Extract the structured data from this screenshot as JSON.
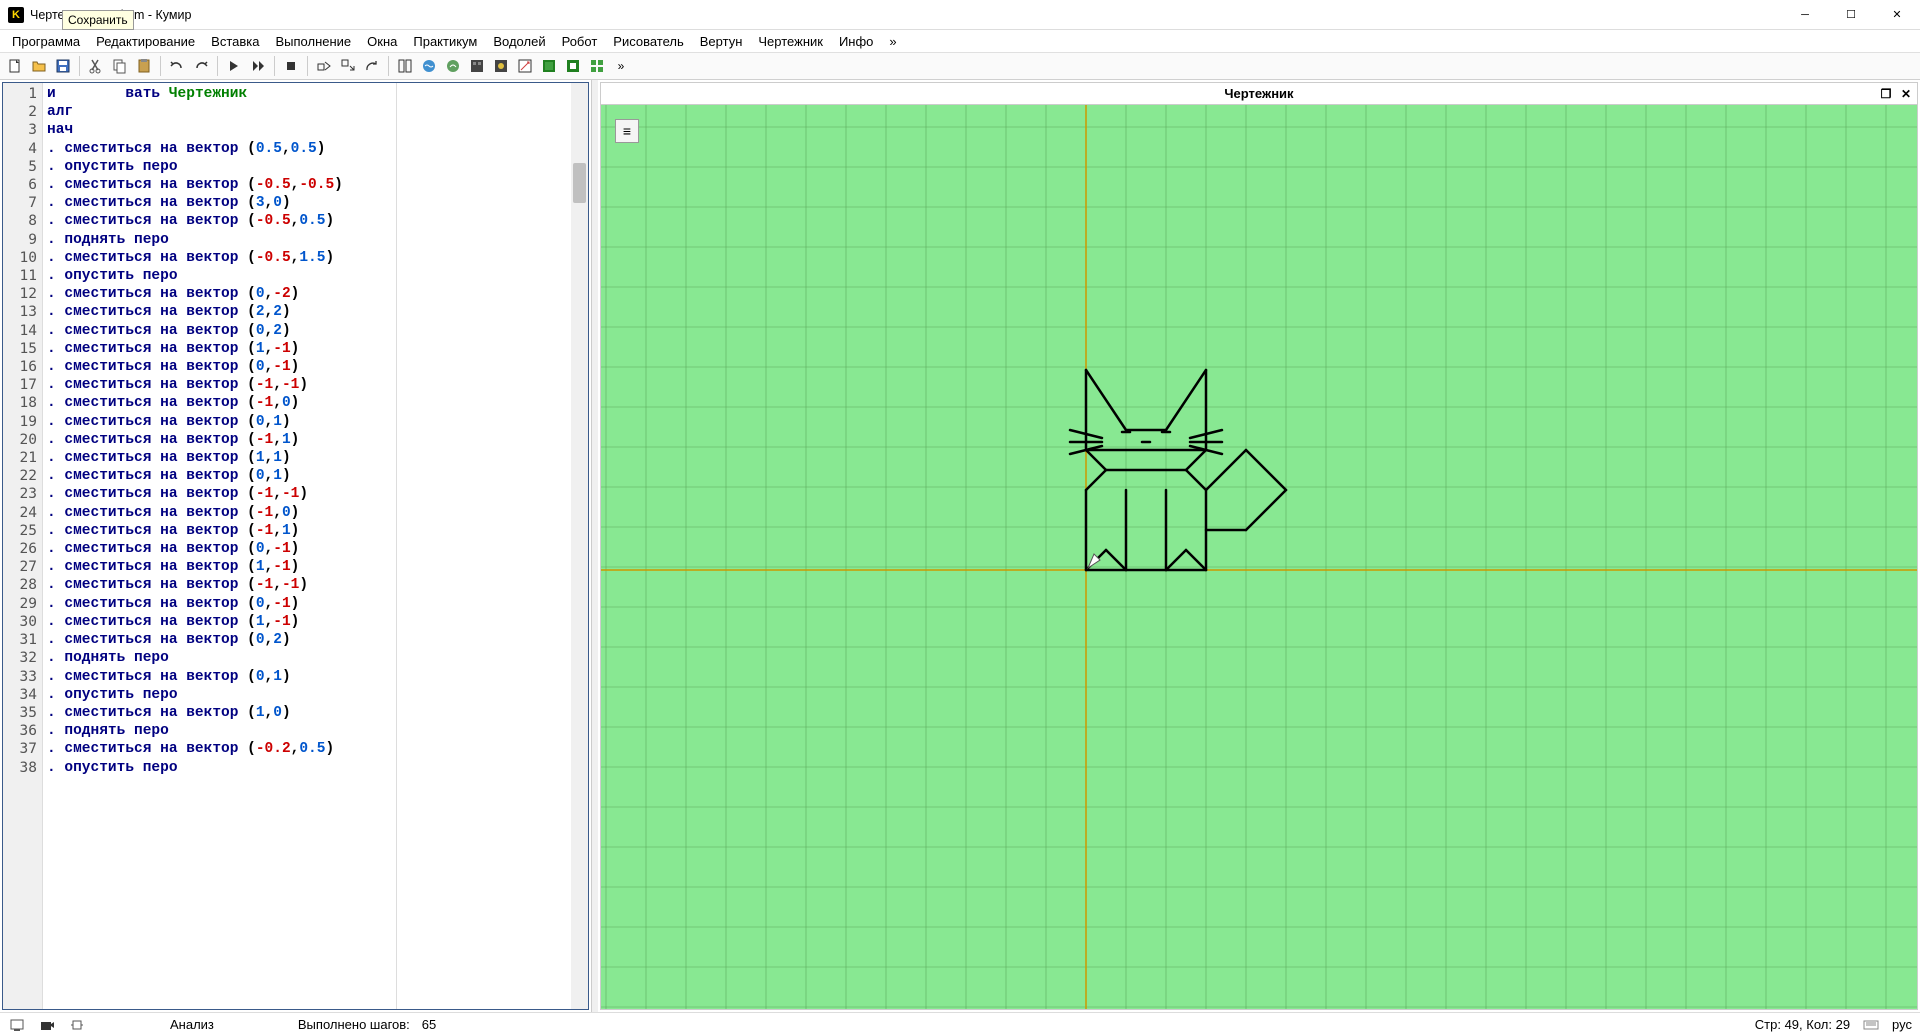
{
  "window": {
    "title": "Чертежник_Кот.kum - Кумир"
  },
  "menu": [
    "Программа",
    "Редактирование",
    "Вставка",
    "Выполнение",
    "Окна",
    "Практикум",
    "Водолей",
    "Робот",
    "Рисователь",
    "Вертун",
    "Чертежник",
    "Инфо",
    "»"
  ],
  "tooltip": "Сохранить",
  "code": [
    {
      "n": 1,
      "t": "kw",
      "a": "и",
      "b": "вать",
      "gr": "Чертежник",
      "prefix": true
    },
    {
      "n": 2,
      "t": "kw",
      "a": "алг"
    },
    {
      "n": 3,
      "t": "kw",
      "a": "нач"
    },
    {
      "n": 4,
      "cmd": "сместиться на вектор",
      "args": [
        "0.5",
        "0.5"
      ]
    },
    {
      "n": 5,
      "cmd": "опустить перо"
    },
    {
      "n": 6,
      "cmd": "сместиться на вектор",
      "args": [
        "-0.5",
        "-0.5"
      ]
    },
    {
      "n": 7,
      "cmd": "сместиться на вектор",
      "args": [
        "3",
        "0"
      ]
    },
    {
      "n": 8,
      "cmd": "сместиться на вектор",
      "args": [
        "-0.5",
        "0.5"
      ]
    },
    {
      "n": 9,
      "cmd": "поднять перо"
    },
    {
      "n": 10,
      "cmd": "сместиться на вектор",
      "args": [
        "-0.5",
        "1.5"
      ]
    },
    {
      "n": 11,
      "cmd": "опустить перо"
    },
    {
      "n": 12,
      "cmd": "сместиться на вектор",
      "args": [
        "0",
        "-2"
      ]
    },
    {
      "n": 13,
      "cmd": "сместиться на вектор",
      "args": [
        "2",
        "2"
      ]
    },
    {
      "n": 14,
      "cmd": "сместиться на вектор",
      "args": [
        "0",
        "2"
      ]
    },
    {
      "n": 15,
      "cmd": "сместиться на вектор",
      "args": [
        "1",
        "-1"
      ]
    },
    {
      "n": 16,
      "cmd": "сместиться на вектор",
      "args": [
        "0",
        "-1"
      ]
    },
    {
      "n": 17,
      "cmd": "сместиться на вектор",
      "args": [
        "-1",
        "-1"
      ]
    },
    {
      "n": 18,
      "cmd": "сместиться на вектор",
      "args": [
        "-1",
        "0"
      ]
    },
    {
      "n": 19,
      "cmd": "сместиться на вектор",
      "args": [
        "0",
        "1"
      ]
    },
    {
      "n": 20,
      "cmd": "сместиться на вектор",
      "args": [
        "-1",
        "1"
      ]
    },
    {
      "n": 21,
      "cmd": "сместиться на вектор",
      "args": [
        "1",
        "1"
      ]
    },
    {
      "n": 22,
      "cmd": "сместиться на вектор",
      "args": [
        "0",
        "1"
      ]
    },
    {
      "n": 23,
      "cmd": "сместиться на вектор",
      "args": [
        "-1",
        "-1"
      ]
    },
    {
      "n": 24,
      "cmd": "сместиться на вектор",
      "args": [
        "-1",
        "0"
      ]
    },
    {
      "n": 25,
      "cmd": "сместиться на вектор",
      "args": [
        "-1",
        "1"
      ]
    },
    {
      "n": 26,
      "cmd": "сместиться на вектор",
      "args": [
        "0",
        "-1"
      ]
    },
    {
      "n": 27,
      "cmd": "сместиться на вектор",
      "args": [
        "1",
        "-1"
      ]
    },
    {
      "n": 28,
      "cmd": "сместиться на вектор",
      "args": [
        "-1",
        "-1"
      ]
    },
    {
      "n": 29,
      "cmd": "сместиться на вектор",
      "args": [
        "0",
        "-1"
      ]
    },
    {
      "n": 30,
      "cmd": "сместиться на вектор",
      "args": [
        "1",
        "-1"
      ]
    },
    {
      "n": 31,
      "cmd": "сместиться на вектор",
      "args": [
        "0",
        "2"
      ]
    },
    {
      "n": 32,
      "cmd": "поднять перо"
    },
    {
      "n": 33,
      "cmd": "сместиться на вектор",
      "args": [
        "0",
        "1"
      ]
    },
    {
      "n": 34,
      "cmd": "опустить перо"
    },
    {
      "n": 35,
      "cmd": "сместиться на вектор",
      "args": [
        "1",
        "0"
      ]
    },
    {
      "n": 36,
      "cmd": "поднять перо"
    },
    {
      "n": 37,
      "cmd": "сместиться на вектор",
      "args": [
        "-0.2",
        "0.5"
      ]
    },
    {
      "n": 38,
      "cmd": "опустить перо"
    }
  ],
  "right_panel": {
    "title": "Чертежник"
  },
  "status": {
    "analysis": "Анализ",
    "steps_label": "Выполнено шагов:",
    "steps_value": "65",
    "line_col": "Стр: 49, Кол: 29",
    "lang": "рус"
  }
}
